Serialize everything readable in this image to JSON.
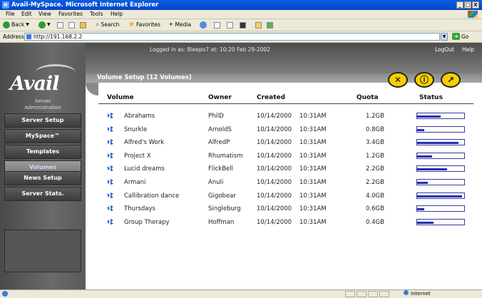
{
  "window": {
    "title": "Avail-MySpace. Microsoft Internet Explorer",
    "buttons": [
      "_",
      "□",
      "X"
    ]
  },
  "menu": [
    "File",
    "Edit",
    "View",
    "Favorites",
    "Tools",
    "Help"
  ],
  "toolbar": {
    "back": "Back",
    "search": "Search",
    "favorites": "Favorites",
    "media": "Media"
  },
  "address": {
    "label": "Address",
    "url": "http://191.168.2.2",
    "go": "Go"
  },
  "header": {
    "logged_in": "Logged in as: Bleepo7 at: 10:20 Feb 29-2002",
    "logout": "LogOut",
    "help": "Help"
  },
  "brand": {
    "logo": "Avail",
    "subtitle_line1": "Server",
    "subtitle_line2": "Administration"
  },
  "nav": [
    {
      "label": "Server Setup",
      "active": false
    },
    {
      "label": "MySpace™",
      "active": false
    },
    {
      "label": "Templates",
      "active": false
    },
    {
      "label": "Volumes",
      "active": true
    },
    {
      "label": "News Setup",
      "active": false
    },
    {
      "label": "Server Stats.",
      "active": false
    }
  ],
  "panel": {
    "title": "Volume Setup (12 Volumes)",
    "actions": [
      "✕",
      "ⓘ",
      "↗"
    ]
  },
  "table": {
    "headers": {
      "volume": "Volume",
      "owner": "Owner",
      "created": "Created",
      "quota": "Quota",
      "status": "Status"
    },
    "rows": [
      {
        "volume": "Abrahams",
        "owner": "PhilD",
        "date": "10/14/2000",
        "time": "10:31AM",
        "quota": "1.2GB",
        "status": 0.5
      },
      {
        "volume": "Snurkle",
        "owner": "ArnoldS",
        "date": "10/14/2000",
        "time": "10:31AM",
        "quota": "0.8GB",
        "status": 0.15
      },
      {
        "volume": "Alfred's Work",
        "owner": "AlfredP",
        "date": "10/14/2000",
        "time": "10:31AM",
        "quota": "3.4GB",
        "status": 0.88
      },
      {
        "volume": "Project X",
        "owner": "Rhumatism",
        "date": "10/14/2000",
        "time": "10:31AM",
        "quota": "1.2GB",
        "status": 0.32
      },
      {
        "volume": "Lucid dreams",
        "owner": "FlickBell",
        "date": "10/14/2000",
        "time": "10:31AM",
        "quota": "2.2GB",
        "status": 0.64
      },
      {
        "volume": "Armani",
        "owner": "Anuli",
        "date": "10/14/2000",
        "time": "10:31AM",
        "quota": "2.2GB",
        "status": 0.22
      },
      {
        "volume": "Callibration dance",
        "owner": "Gigobear",
        "date": "10/14/2000",
        "time": "10:31AM",
        "quota": "4.0GB",
        "status": 0.96
      },
      {
        "volume": "Thursdays",
        "owner": "Singleburg",
        "date": "10/14/2000",
        "time": "10:31AM",
        "quota": "0.6GB",
        "status": 0.15
      },
      {
        "volume": "Group Therapy",
        "owner": "Hoffman",
        "date": "10/14/2000",
        "time": "10:31AM",
        "quota": "0.4GB",
        "status": 0.35
      }
    ]
  },
  "statusbar": {
    "zone": "Internet"
  },
  "colors": {
    "accent_yellow": "#f6d000",
    "bar_fill": "#1f2fb0",
    "ie_blue": "#0a5fe0"
  }
}
